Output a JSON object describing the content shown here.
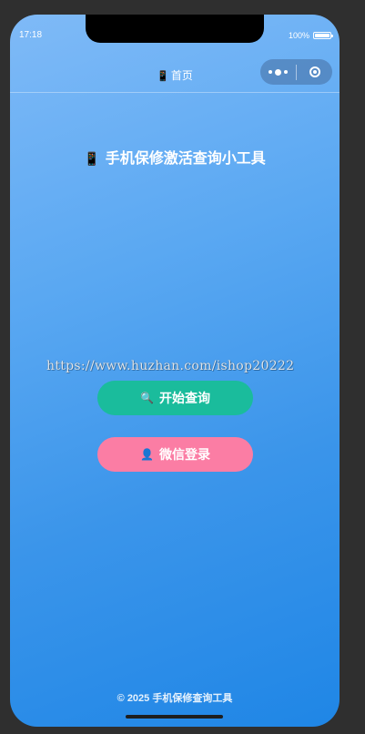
{
  "status_bar": {
    "time": "17:18",
    "battery_text": "100%"
  },
  "nav": {
    "title_icon": "📱",
    "title": "首页"
  },
  "app": {
    "title_icon": "📱",
    "title": "手机保修激活查询小工具"
  },
  "watermark": "https://www.huzhan.com/ishop20222",
  "buttons": {
    "start_icon": "🔍",
    "start_label": "开始查询",
    "wechat_icon": "👤",
    "wechat_label": "微信登录"
  },
  "footer": "© 2025 手机保修查询工具",
  "colors": {
    "start_button": "#1abc9c",
    "wechat_button": "#fb7da4",
    "gradient_start": "#7fbaf7",
    "gradient_end": "#1f86e6"
  }
}
